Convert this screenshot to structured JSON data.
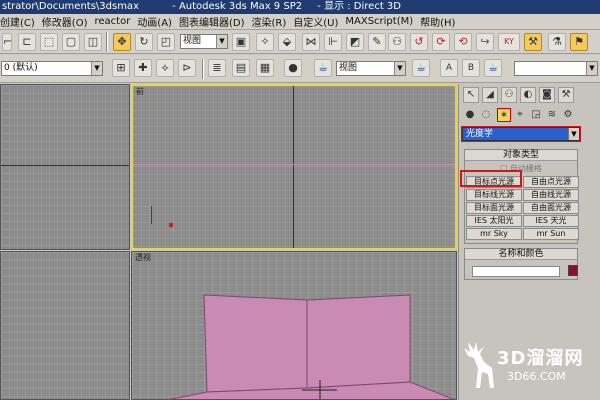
{
  "window": {
    "title_path": "strator\\Documents\\3dsmax",
    "app_name": "- Autodesk 3ds Max 9 SP2",
    "display_mode": "- 显示 : Direct 3D"
  },
  "menubar": {
    "items": [
      "创建(C)",
      "修改器(O)",
      "reactor",
      "动画(A)",
      "图表编辑器(D)",
      "渲染(R)",
      "自定义(U)",
      "MAXScript(M)",
      "帮助(H)"
    ]
  },
  "toolbar1": {
    "view_dropdown": "视图"
  },
  "toolbar2": {
    "layer_dropdown": "0 (默认)",
    "view_dropdown2": "视图",
    "named_selection_dropdown": ""
  },
  "viewports": {
    "top_right_label": "前",
    "bottom_right_label": "透视"
  },
  "command_panel": {
    "category_dropdown": "光度学",
    "object_type_title": "对象类型",
    "autogrid_label": "自动栅格",
    "light_buttons": [
      "目标点光源",
      "自由点光源",
      "目标线光源",
      "自由线光源",
      "目标面光源",
      "自由面光源",
      "IES 太阳光",
      "IES 天光",
      "mr Sky",
      "mr Sun"
    ],
    "name_color_title": "名称和颜色"
  },
  "colors": {
    "active_viewport_border": "#e8d24a",
    "highlight_frame": "#d01818",
    "selected_category": "#2a5fcf",
    "object_color": "#8b1030"
  },
  "watermark": {
    "title": "3D溜溜网",
    "subtitle": "3D66.COM"
  }
}
